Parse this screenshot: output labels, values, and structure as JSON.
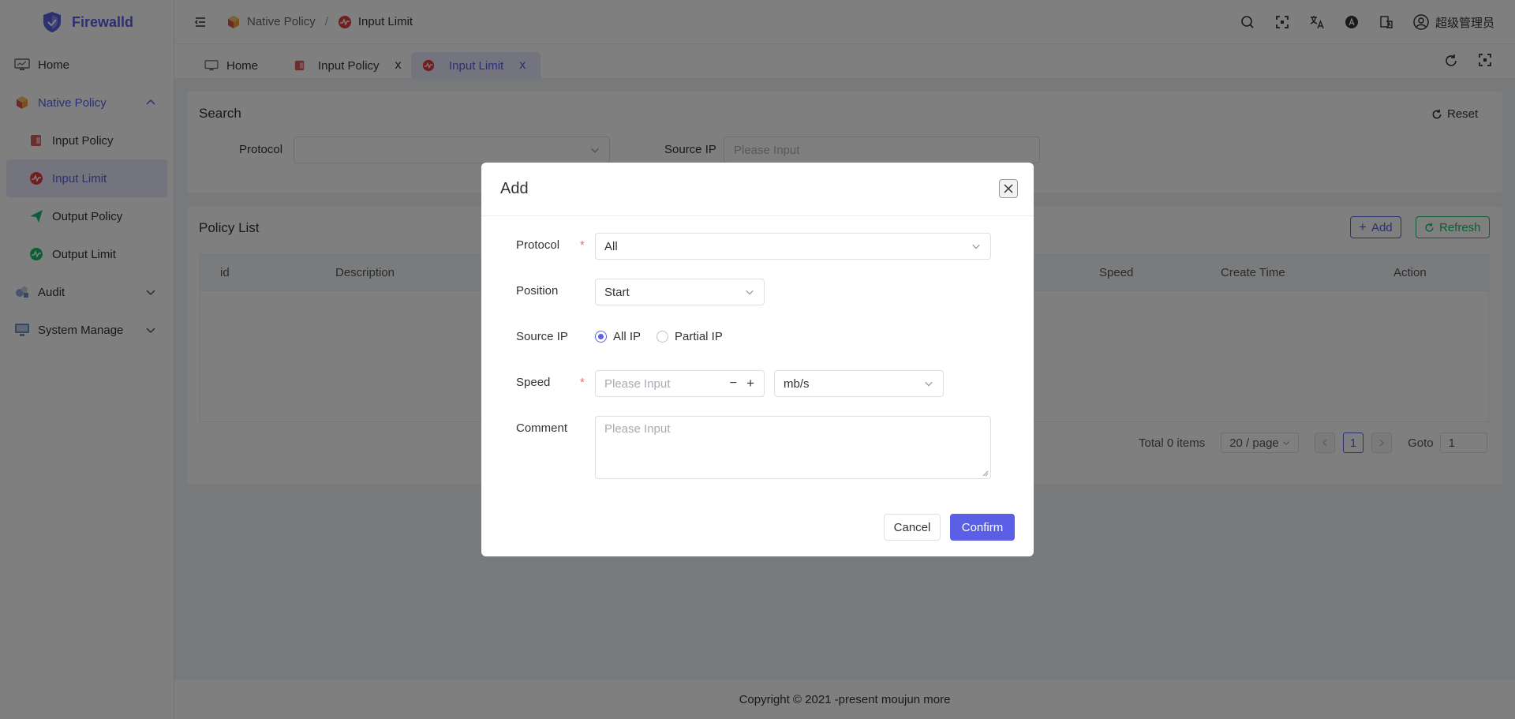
{
  "app": {
    "name": "Firewalld"
  },
  "sidebar": {
    "items": [
      {
        "label": "Home",
        "icon": "monitor-icon"
      },
      {
        "label": "Native Policy",
        "icon": "cube-icon"
      },
      {
        "label": "Input Policy",
        "icon": "input-policy-icon"
      },
      {
        "label": "Input Limit",
        "icon": "input-limit-icon"
      },
      {
        "label": "Output Policy",
        "icon": "send-icon"
      },
      {
        "label": "Output Limit",
        "icon": "output-limit-icon"
      },
      {
        "label": "Audit",
        "icon": "audit-icon"
      },
      {
        "label": "System Manage",
        "icon": "system-icon"
      }
    ]
  },
  "header": {
    "breadcrumb": [
      "Native Policy",
      "Input Limit"
    ],
    "separator": "/",
    "user": "超级管理员"
  },
  "tabs": [
    {
      "label": "Home"
    },
    {
      "label": "Input Policy",
      "close": "x"
    },
    {
      "label": "Input Limit",
      "close": "x"
    }
  ],
  "search": {
    "title": "Search",
    "reset": "Reset",
    "protocol_label": "Protocol",
    "source_ip_label": "Source IP",
    "source_ip_placeholder": "Please Input"
  },
  "list": {
    "title": "Policy List",
    "add": "Add",
    "refresh": "Refresh",
    "columns": [
      "id",
      "Description",
      "Speed",
      "Create Time",
      "Action"
    ]
  },
  "pagination": {
    "total": "Total 0 items",
    "page_size": "20 / page",
    "current_page": "1",
    "goto_label": "Goto",
    "goto_value": "1"
  },
  "footer": {
    "copyright": "Copyright © 2021 -present moujun more"
  },
  "modal": {
    "title": "Add",
    "protocol_label": "Protocol",
    "protocol_value": "All",
    "position_label": "Position",
    "position_value": "Start",
    "source_ip_label": "Source IP",
    "radio_all": "All IP",
    "radio_partial": "Partial IP",
    "speed_label": "Speed",
    "speed_placeholder": "Please Input",
    "unit_value": "mb/s",
    "comment_label": "Comment",
    "comment_placeholder": "Please Input",
    "required_mark": "*",
    "cancel": "Cancel",
    "confirm": "Confirm"
  },
  "colors": {
    "accent": "#5b5fe6",
    "success": "#19be6b",
    "required": "#f56c6c"
  }
}
